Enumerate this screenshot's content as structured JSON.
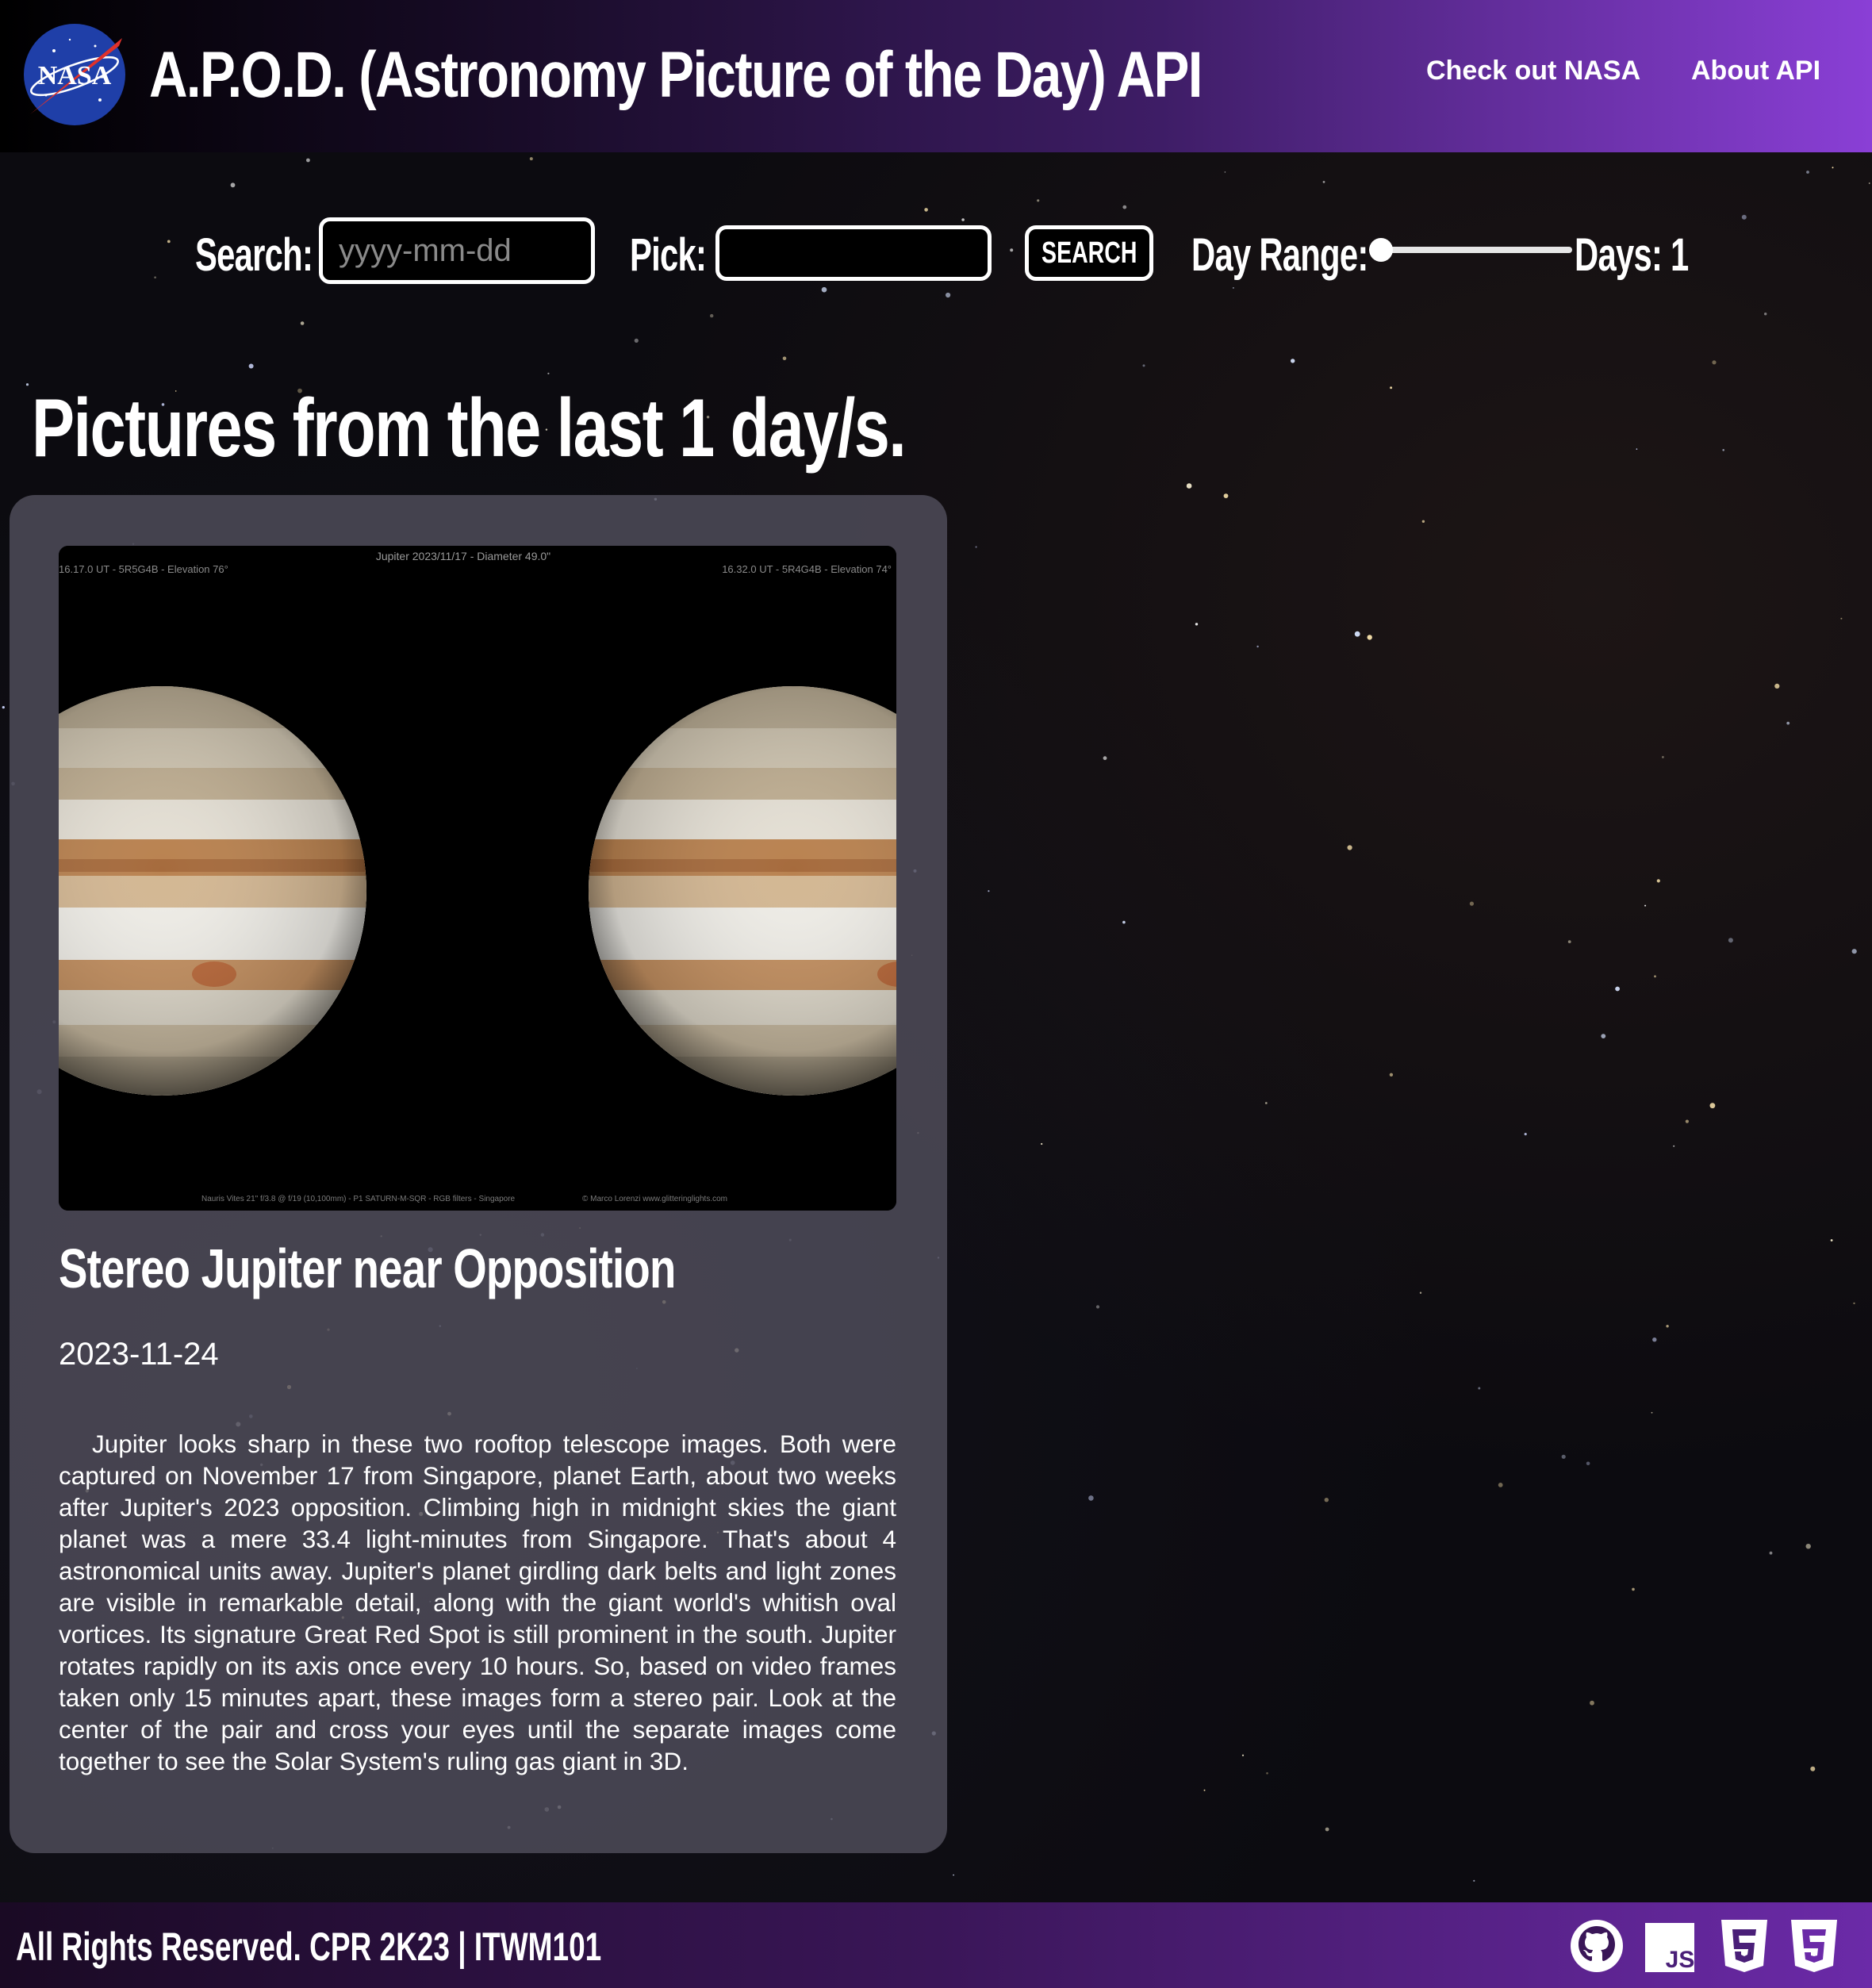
{
  "header": {
    "logo_text": "NASA",
    "title": "A.P.O.D. (Astronomy Picture of the Day) API",
    "nav": [
      {
        "label": "Check out NASA"
      },
      {
        "label": "About API"
      }
    ]
  },
  "controls": {
    "search_label": "Search:",
    "search_placeholder": "yyyy-mm-dd",
    "pick_label": "Pick:",
    "search_button": "SEARCH",
    "range_label": "Day Range:",
    "days_label": "Days: 1",
    "range_value": 1
  },
  "heading": "Pictures from the last 1 day/s.",
  "card": {
    "image": {
      "caption_top": "Jupiter  2023/11/17 - Diameter 49.0\"",
      "caption_left": "16.17.0 UT - 5R5G4B - Elevation 76°",
      "caption_right": "16.32.0 UT - 5R4G4B - Elevation 74°",
      "caption_bottom_left": "Nauris Vites 21\" f/3.8 @ f/19 (10,100mm) - P1 SATURN-M-SQR - RGB filters - Singapore",
      "caption_bottom_right": "© Marco Lorenzi www.glitteringlights.com"
    },
    "title": "Stereo Jupiter near Opposition",
    "date": "2023-11-24",
    "description": "Jupiter looks sharp in these two rooftop telescope images. Both were captured on November 17 from Singapore, planet Earth, about two weeks after Jupiter's 2023 opposition. Climbing high in midnight skies the giant planet was a mere 33.4 light-minutes from Singapore. That's about 4 astronomical units away. Jupiter's planet girdling dark belts and light zones are visible in remarkable detail, along with the giant world's whitish oval vortices. Its signature Great Red Spot is still prominent in the south. Jupiter rotates rapidly on its axis once every 10 hours. So, based on video frames taken only 15 minutes apart, these images form a stereo pair. Look at the center of the pair and cross your eyes until the separate images come together to see the Solar System's ruling gas giant in 3D."
  },
  "footer": {
    "text": "All Rights Reserved. CPR 2K23 | ITWM101",
    "icons": [
      "github-icon",
      "javascript-icon",
      "html5-icon",
      "css3-icon"
    ],
    "js_text": "JS"
  },
  "colors": {
    "header_gradient_start": "#000000",
    "header_gradient_end": "#8a3fd6",
    "card_bg": "#504e5c"
  }
}
